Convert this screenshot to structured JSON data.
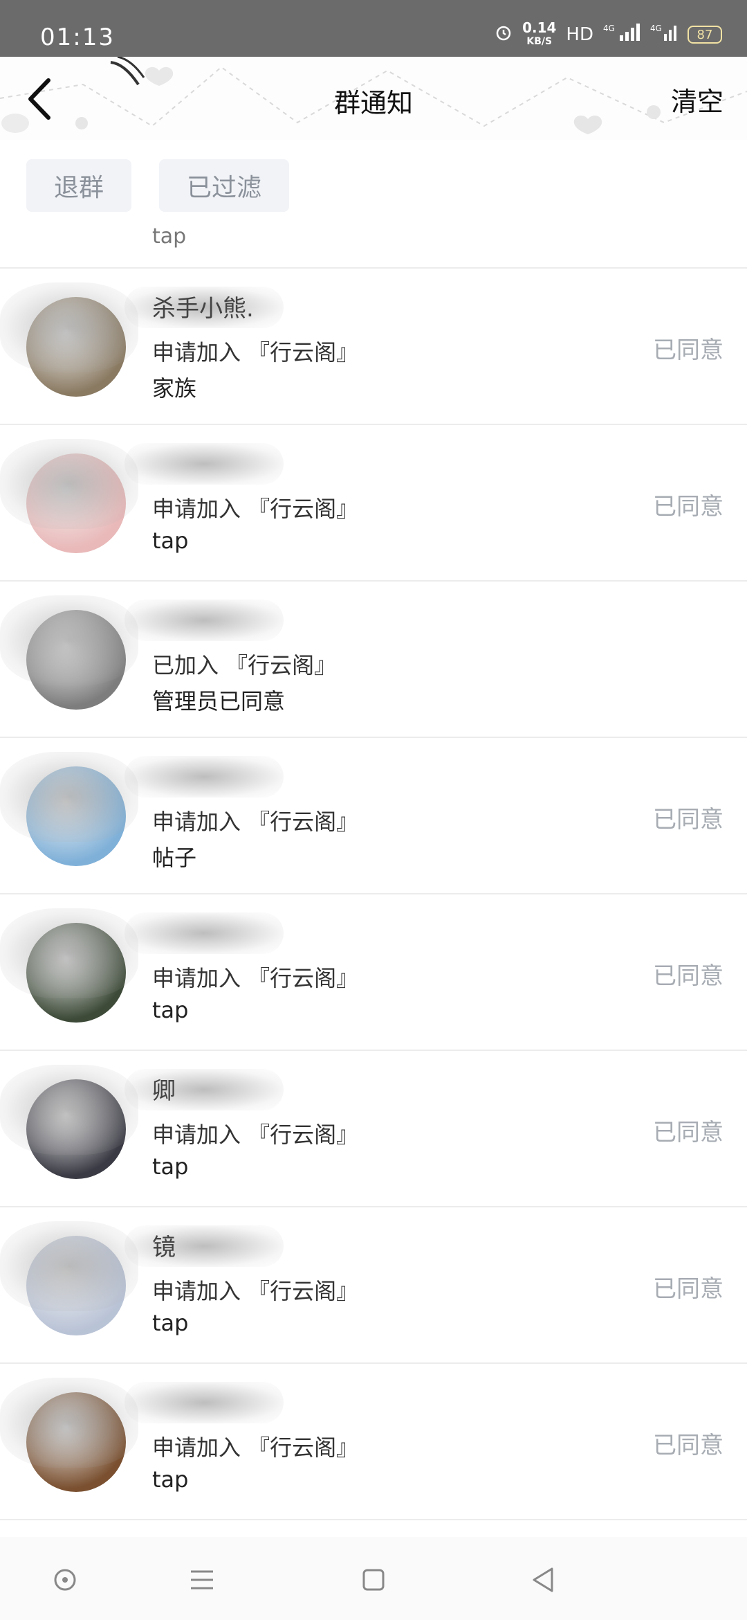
{
  "status_bar": {
    "time": "01:13",
    "speed_value": "0.14",
    "speed_unit": "KB/S",
    "hd": "HD",
    "net1": "4G",
    "net2": "4G",
    "battery": "87"
  },
  "header": {
    "title": "群通知",
    "clear_label": "清空",
    "back_icon": "chevron-left-icon"
  },
  "filters": {
    "quit_label": "退群",
    "filtered_label": "已过滤"
  },
  "partial_row": {
    "subtitle": "tap"
  },
  "notifications": [
    {
      "name": "杀手小熊.",
      "line1": "申请加入 『行云阁』",
      "line2": "家族",
      "status": "已同意",
      "avatar_color": "#8a7a62"
    },
    {
      "name": "",
      "line1": "申请加入 『行云阁』",
      "line2": "tap",
      "status": "已同意",
      "avatar_color": "#e9b8b8"
    },
    {
      "name": "",
      "line1": "已加入 『行云阁』",
      "line2": "管理员已同意",
      "status": "",
      "avatar_color": "#7d7d7d"
    },
    {
      "name": "",
      "line1": "申请加入 『行云阁』",
      "line2": "帖子",
      "status": "已同意",
      "avatar_color": "#7fb0d8"
    },
    {
      "name": "",
      "line1": "申请加入 『行云阁』",
      "line2": "tap",
      "status": "已同意",
      "avatar_color": "#3d4a38"
    },
    {
      "name": "卿",
      "line1": "申请加入 『行云阁』",
      "line2": "tap",
      "status": "已同意",
      "avatar_color": "#3a3a44"
    },
    {
      "name": "镜",
      "line1": "申请加入 『行云阁』",
      "line2": "tap",
      "status": "已同意",
      "avatar_color": "#b9c3d6"
    },
    {
      "name": "",
      "line1": "申请加入 『行云阁』",
      "line2": "tap",
      "status": "已同意",
      "avatar_color": "#7a5030"
    }
  ],
  "nav": {
    "home_icon": "circle-dot-icon",
    "menu_icon": "menu-icon",
    "recent_icon": "square-icon",
    "back_icon": "triangle-back-icon"
  }
}
